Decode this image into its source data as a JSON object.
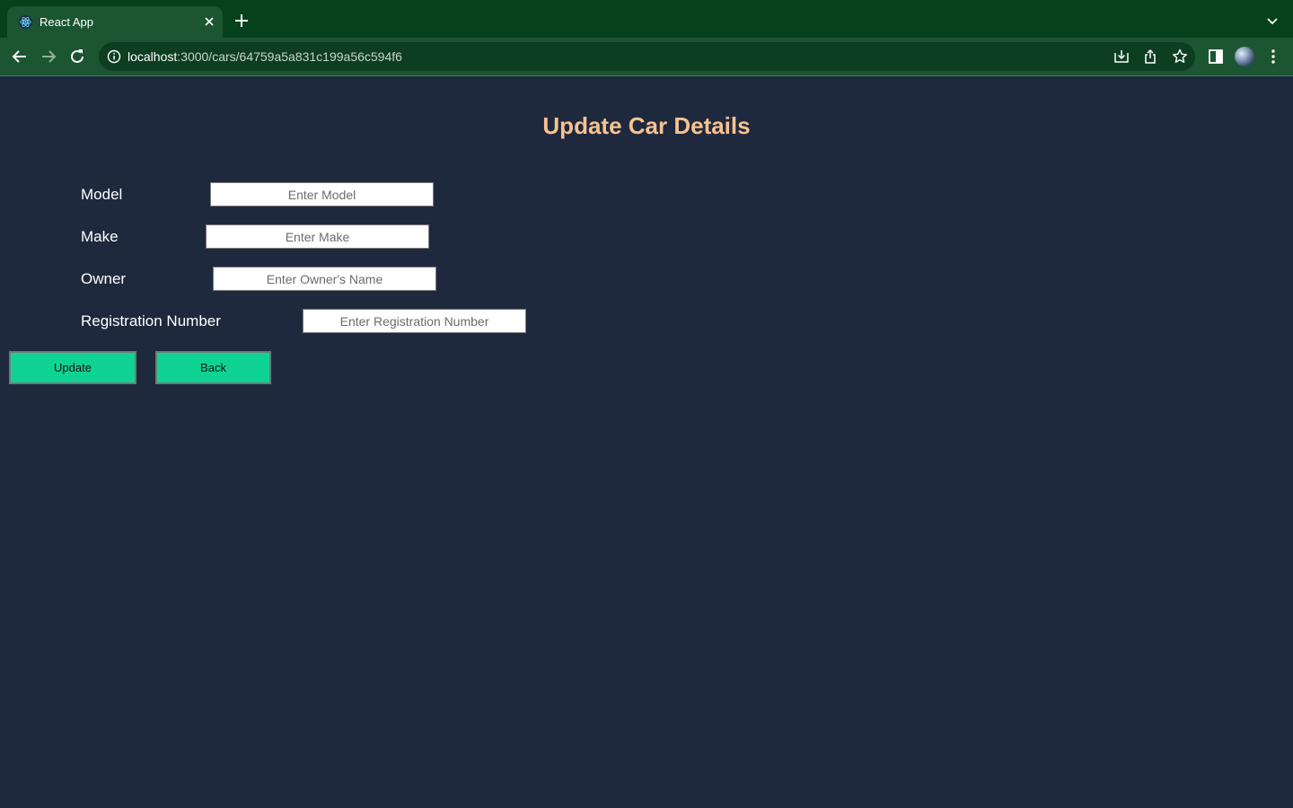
{
  "browser": {
    "tab_title": "React App",
    "url_host": "localhost",
    "url_path": ":3000/cars/64759a5a831c199a56c594f6",
    "icons": {
      "favicon": "react-icon",
      "tab_close": "close-icon",
      "new_tab": "plus-icon",
      "tab_list": "chevron-down-icon",
      "back": "arrow-left-icon",
      "forward": "arrow-right-icon",
      "reload": "reload-icon",
      "site_info": "info-icon",
      "install": "install-icon",
      "share": "share-icon",
      "bookmark": "star-icon",
      "side_panel": "side-panel-icon",
      "profile": "avatar",
      "menu": "kebab-menu-icon"
    },
    "colors": {
      "tab_strip": "#05411c",
      "toolbar": "#1b5531"
    }
  },
  "form": {
    "title": "Update Car Details",
    "fields": [
      {
        "label": "Model",
        "placeholder": "Enter Model",
        "value": ""
      },
      {
        "label": "Make",
        "placeholder": "Enter Make",
        "value": ""
      },
      {
        "label": "Owner",
        "placeholder": "Enter Owner's Name",
        "value": ""
      },
      {
        "label": "Registration Number",
        "placeholder": "Enter Registration Number",
        "value": ""
      }
    ],
    "update_label": "Update",
    "back_label": "Back"
  },
  "colors": {
    "page_background": "#1f293d",
    "title": "#f8c291",
    "button": "#0fd393"
  }
}
